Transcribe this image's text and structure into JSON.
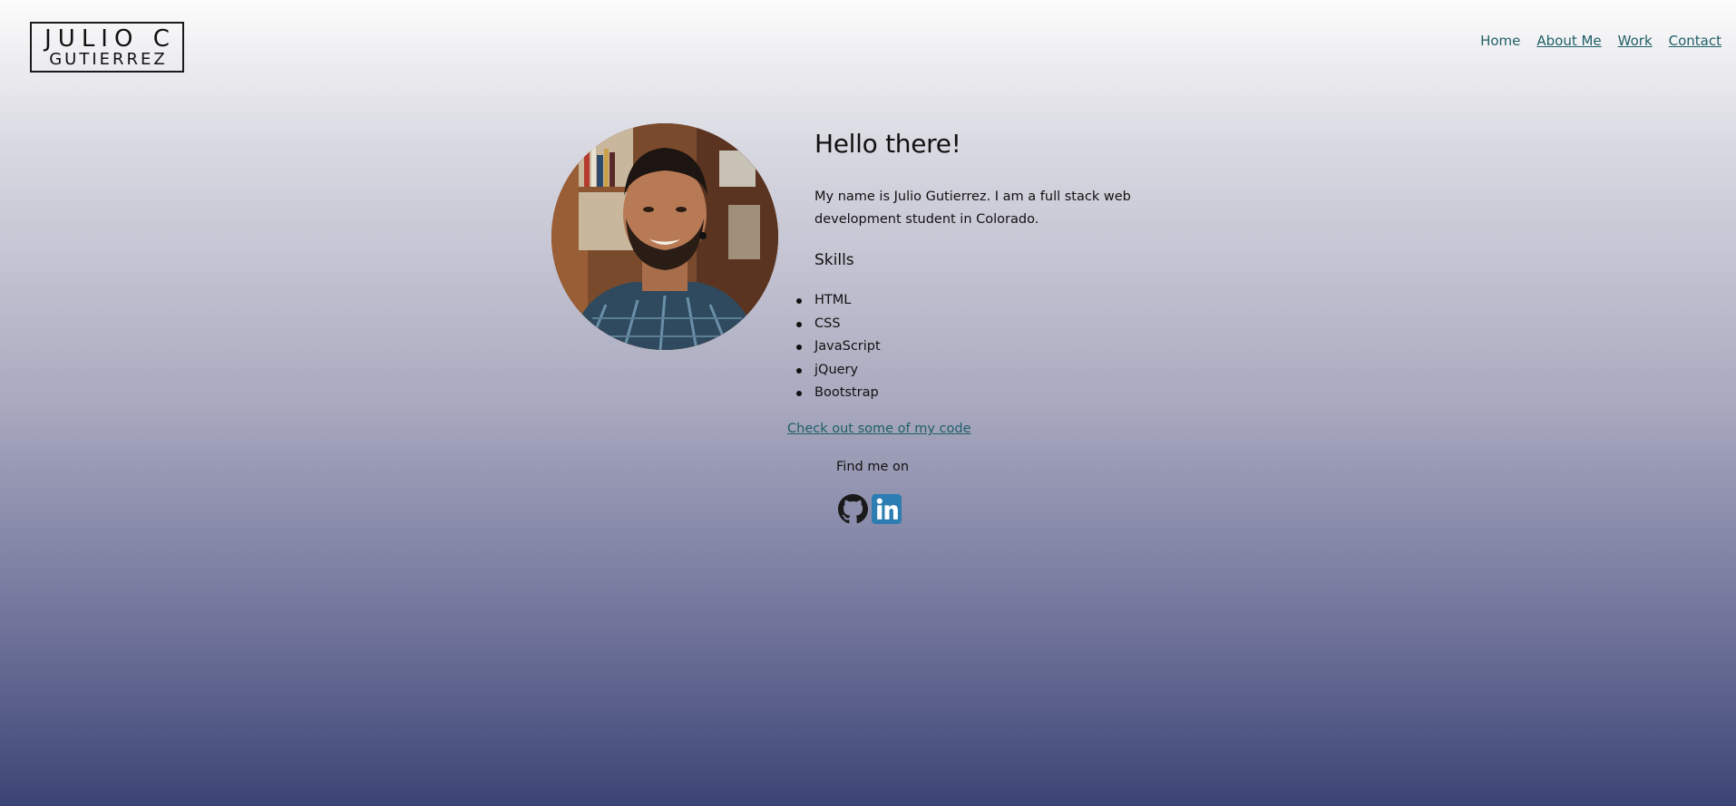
{
  "logo": {
    "line1": "JULIO C",
    "line2": "GUTIERREZ"
  },
  "nav": {
    "items": [
      {
        "label": "Home"
      },
      {
        "label": "About Me"
      },
      {
        "label": "Work"
      },
      {
        "label": "Contact"
      }
    ]
  },
  "main": {
    "heading": "Hello there!",
    "bio": "My name is Julio Gutierrez. I am a full stack web development student in Colorado.",
    "skills_heading": "Skills",
    "skills": [
      "HTML",
      "CSS",
      "JavaScript",
      "jQuery",
      "Bootstrap"
    ],
    "code_link": "Check out some of my code",
    "find_me": "Find me on"
  },
  "socials": [
    {
      "icon": "github-icon"
    },
    {
      "icon": "linkedin-icon"
    }
  ],
  "colors": {
    "link": "#1f5f66",
    "linkedin": "#2c7db2"
  }
}
